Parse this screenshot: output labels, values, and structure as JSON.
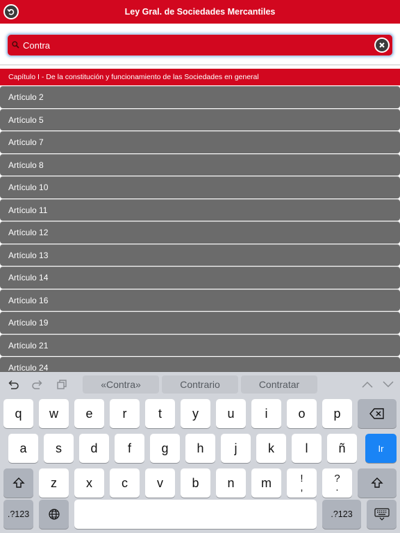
{
  "header": {
    "title": "Ley Gral. de Sociedades Mercantiles"
  },
  "search": {
    "value": "Contra",
    "placeholder": ""
  },
  "list": {
    "chapter": "Capítulo I - De la constitución y funcionamiento de las Sociedades en general",
    "items": [
      "Artículo 2",
      "Artículo 5",
      "Artículo 7",
      "Artículo 8",
      "Artículo 10",
      "Artículo 11",
      "Artículo 12",
      "Artículo 13",
      "Artículo 14",
      "Artículo 16",
      "Artículo 19",
      "Artículo 21",
      "Artículo 24"
    ]
  },
  "keyboard": {
    "suggestions": [
      "«Contra»",
      "Contrario",
      "Contratar"
    ],
    "row1": [
      "q",
      "w",
      "e",
      "r",
      "t",
      "y",
      "u",
      "i",
      "o",
      "p"
    ],
    "row2": [
      "a",
      "s",
      "d",
      "f",
      "g",
      "h",
      "j",
      "k",
      "l",
      "ñ"
    ],
    "row3": [
      "z",
      "x",
      "c",
      "v",
      "b",
      "n",
      "m"
    ],
    "punct1": [
      "!",
      ","
    ],
    "punct2": [
      "?",
      "."
    ],
    "go_label": "Ir",
    "numbers_label": ".?123"
  },
  "colors": {
    "accent": "#d2071f",
    "row_bg": "#6b6b6b",
    "keyboard_bg": "#d1d4da",
    "go_key": "#1a84f5"
  }
}
